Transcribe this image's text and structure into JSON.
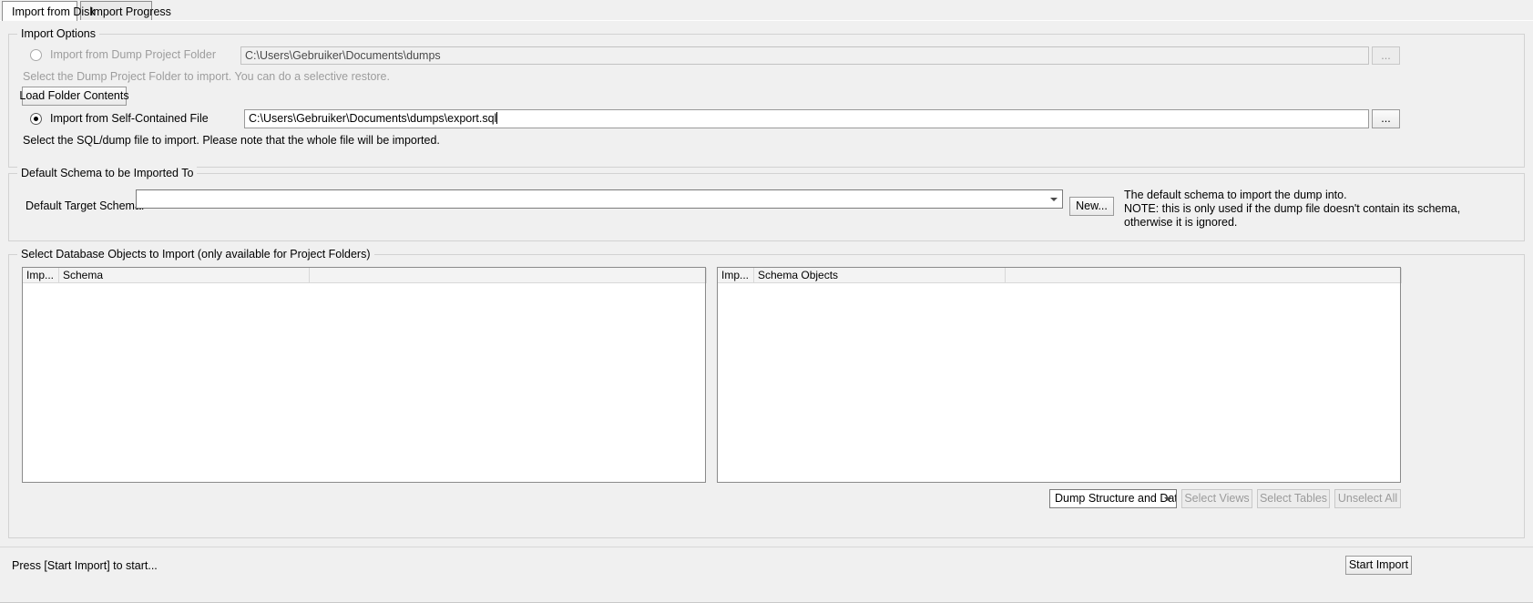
{
  "tabs": [
    {
      "label": "Import from Disk",
      "active": true
    },
    {
      "label": "Import Progress",
      "active": false
    }
  ],
  "import_options": {
    "group_title": "Import Options",
    "dump_folder": {
      "radio_label": "Import from Dump Project Folder",
      "selected": false,
      "path_value": "C:\\Users\\Gebruiker\\Documents\\dumps",
      "browse_label": "...",
      "hint": "Select the Dump Project Folder to import. You can do a selective restore.",
      "load_button": "Load Folder Contents"
    },
    "self_contained": {
      "radio_label": "Import from Self-Contained File",
      "selected": true,
      "path_value": "C:\\Users\\Gebruiker\\Documents\\dumps\\export.sql",
      "browse_label": "...",
      "hint": "Select the SQL/dump file to import. Please note that the whole file will be imported."
    }
  },
  "default_schema": {
    "group_title": "Default Schema to be Imported To",
    "field_label": "Default Target Schema:",
    "combo_value": "",
    "new_button": "New...",
    "note_line1": "The default schema to import the dump into.",
    "note_line2": "NOTE: this is only used if the dump file doesn't contain its schema,",
    "note_line3": "otherwise it is ignored."
  },
  "objects": {
    "group_title": "Select Database Objects to Import (only available for Project Folders)",
    "left_list": {
      "columns": [
        "Imp...",
        "Schema",
        ""
      ],
      "rows": []
    },
    "right_list": {
      "columns": [
        "Imp...",
        "Schema Objects",
        ""
      ],
      "rows": []
    },
    "dump_type_combo": "Dump Structure and Dat",
    "select_views_button": "Select Views",
    "select_tables_button": "Select Tables",
    "unselect_all_button": "Unselect All"
  },
  "statusbar": {
    "message": "Press [Start Import] to start...",
    "start_button": "Start Import"
  },
  "colors": {
    "window_bg": "#f0f0f0",
    "field_bg": "#ffffff",
    "disabled_text": "#9b9b9b",
    "border": "#8a8a8a"
  }
}
